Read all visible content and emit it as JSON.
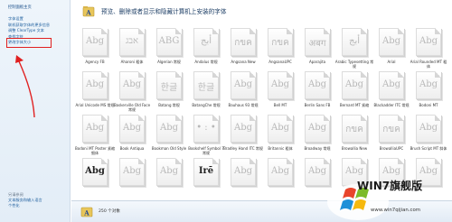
{
  "sidebar": {
    "home": "控制面板主页",
    "items": [
      {
        "label": "字体设置"
      },
      {
        "label": "联机获取字体的更多信息"
      },
      {
        "label": "调整 ClearType 文本"
      },
      {
        "label": "查找字符"
      },
      {
        "label": "更改字体大小",
        "active": true
      }
    ],
    "see_also": {
      "title": "另请参阅",
      "items": [
        "文本服务和输入语言",
        "个性化"
      ]
    }
  },
  "header": {
    "title": "预览、删除或者显示和隐藏计算机上安装的字体"
  },
  "fonts": [
    {
      "name": "Agency FB",
      "sample": "Abg"
    },
    {
      "name": "Aharoni 粗体",
      "sample": "אבג"
    },
    {
      "name": "Algerian 常规",
      "sample": "ABG"
    },
    {
      "name": "Andalus 常规",
      "sample": "أبج"
    },
    {
      "name": "Angsana New",
      "sample": "กขค"
    },
    {
      "name": "AngsanaUPC",
      "sample": "กขค"
    },
    {
      "name": "Aparajita",
      "sample": "अबग"
    },
    {
      "name": "Arabic Typesetting 常规",
      "sample": "أبج"
    },
    {
      "name": "Arial",
      "sample": "Abg"
    },
    {
      "name": "Arial Rounded MT 粗体",
      "sample": "Abg"
    },
    {
      "name": "Arial Unicode MS 常规",
      "sample": "Abg"
    },
    {
      "name": "Baskerville Old Face 常规",
      "sample": "Abg"
    },
    {
      "name": "Batang 常规",
      "sample": "한글"
    },
    {
      "name": "BatangChe 常规",
      "sample": "한글"
    },
    {
      "name": "Bauhaus 93 常规",
      "sample": "Abg"
    },
    {
      "name": "Bell MT",
      "sample": "Abg"
    },
    {
      "name": "Berlin Sans FB",
      "sample": "Abg"
    },
    {
      "name": "Bernard MT 紧缩",
      "sample": "Abg"
    },
    {
      "name": "Blackadder ITC 常规",
      "sample": "Abg"
    },
    {
      "name": "Bodoni MT",
      "sample": "Abg"
    },
    {
      "name": "Bodoni MT Poster 紧缩 细体",
      "sample": "Abg"
    },
    {
      "name": "Book Antiqua",
      "sample": "Abg"
    },
    {
      "name": "Bookman Old Style",
      "sample": "Abg"
    },
    {
      "name": "Bookshelf Symbol 7 常规",
      "sample": "• : •"
    },
    {
      "name": "Bradley Hand ITC 常规",
      "sample": "Abg"
    },
    {
      "name": "Britannic 粗体",
      "sample": "Abg"
    },
    {
      "name": "Broadway 常规",
      "sample": "Abg"
    },
    {
      "name": "Browallia New",
      "sample": "กขค"
    },
    {
      "name": "BrowalliaUPC",
      "sample": "กขค"
    },
    {
      "name": "Brush Script MT 斜体",
      "sample": "Abg"
    },
    {
      "name": "",
      "sample": "Abg",
      "dark": true
    },
    {
      "name": "",
      "sample": "Abg"
    },
    {
      "name": "",
      "sample": "Abg"
    },
    {
      "name": "",
      "sample": "Irē",
      "dark": true
    },
    {
      "name": "",
      "sample": "Abg"
    },
    {
      "name": "",
      "sample": "Abg"
    },
    {
      "name": "",
      "sample": "Abg"
    },
    {
      "name": "",
      "sample": "Abg"
    },
    {
      "name": "",
      "sample": "Abg"
    },
    {
      "name": "",
      "sample": "Abg"
    }
  ],
  "status": {
    "count": "250 个对象"
  },
  "watermark": {
    "brand": "WIN7旗舰版",
    "url": "www.win7qijian.com"
  }
}
